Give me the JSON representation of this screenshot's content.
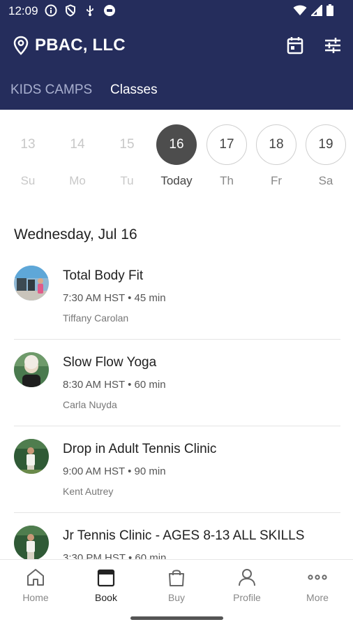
{
  "status_bar": {
    "time": "12:09"
  },
  "header": {
    "org_name": "PBAC, LLC",
    "tabs": [
      {
        "label": "KIDS CAMPS",
        "active": false
      },
      {
        "label": "Classes",
        "active": true
      }
    ]
  },
  "date_strip": {
    "days": [
      {
        "number": "13",
        "label": "Su",
        "state": "past"
      },
      {
        "number": "14",
        "label": "Mo",
        "state": "past"
      },
      {
        "number": "15",
        "label": "Tu",
        "state": "past"
      },
      {
        "number": "16",
        "label": "Today",
        "state": "selected"
      },
      {
        "number": "17",
        "label": "Th",
        "state": "future"
      },
      {
        "number": "18",
        "label": "Fr",
        "state": "future"
      },
      {
        "number": "19",
        "label": "Sa",
        "state": "future"
      }
    ]
  },
  "schedule": {
    "section_title": "Wednesday, Jul 16",
    "classes": [
      {
        "title": "Total Body Fit",
        "time": "7:30 AM HST",
        "duration": "• 45 min",
        "instructor": "Tiffany Carolan"
      },
      {
        "title": "Slow Flow Yoga",
        "time": "8:30 AM HST",
        "duration": "• 60 min",
        "instructor": "Carla Nuyda"
      },
      {
        "title": "Drop in Adult Tennis Clinic",
        "time": "9:00 AM HST",
        "duration": "• 90 min",
        "instructor": "Kent Autrey"
      },
      {
        "title": "Jr Tennis Clinic - AGES 8-13 ALL SKILLS",
        "time": "3:30 PM HST",
        "duration": "• 60 min",
        "instructor": ""
      }
    ]
  },
  "bottom_nav": {
    "items": [
      {
        "label": "Home",
        "icon": "home-icon",
        "active": false
      },
      {
        "label": "Book",
        "icon": "calendar-icon",
        "active": true
      },
      {
        "label": "Buy",
        "icon": "shopping-bag-icon",
        "active": false
      },
      {
        "label": "Profile",
        "icon": "person-icon",
        "active": false
      },
      {
        "label": "More",
        "icon": "more-dots-icon",
        "active": false
      }
    ]
  },
  "colors": {
    "header_bg": "#252d5c",
    "today_circle": "#4d4d4d"
  }
}
